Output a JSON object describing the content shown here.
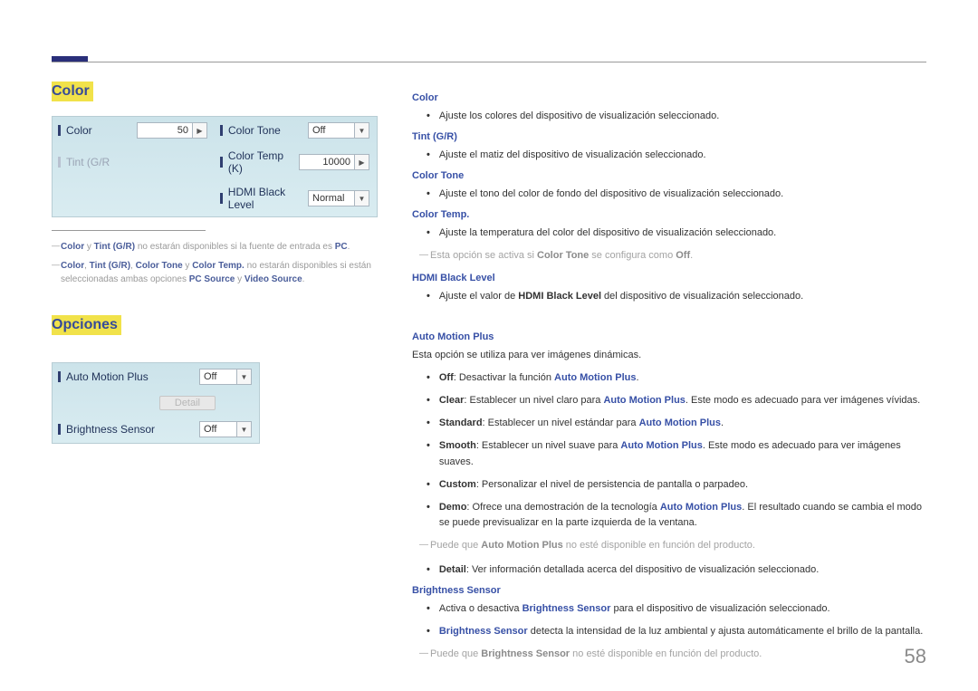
{
  "page_number": "58",
  "left": {
    "section1_title": "Color",
    "panel1": {
      "color_label": "Color",
      "color_value": "50",
      "tint_label": "Tint (G/R",
      "tone_label": "Color Tone",
      "tone_value": "Off",
      "temp_label": "Color Temp (K)",
      "temp_value": "10000",
      "hdmi_label": "HDMI Black Level",
      "hdmi_value": "Normal"
    },
    "fn1": {
      "a": "Color",
      "b": " y ",
      "c": "Tint (G/R)",
      "d": " no estarán disponibles si la fuente de entrada es ",
      "e": "PC",
      "f": "."
    },
    "fn2": {
      "a": "Color",
      "b": ", ",
      "c": "Tint (G/R)",
      "d": ", ",
      "e": "Color Tone",
      "f": " y ",
      "g": "Color Temp.",
      "h": " no estarán disponibles si están seleccionadas ambas opciones ",
      "i": "PC Source",
      "j": " y ",
      "k": "Video Source",
      "l": "."
    },
    "section2_title": "Opciones",
    "panel2": {
      "amp_label": "Auto Motion Plus",
      "amp_value": "Off",
      "detail_label": "Detail",
      "bs_label": "Brightness Sensor",
      "bs_value": "Off"
    }
  },
  "right": {
    "color_head": "Color",
    "color_b1": "Ajuste los colores del dispositivo de visualización seleccionado.",
    "tint_head": "Tint (G/R)",
    "tint_b1": "Ajuste el matiz del dispositivo de visualización seleccionado.",
    "tone_head": "Color Tone",
    "tone_b1": "Ajuste el tono del color de fondo del dispositivo de visualización seleccionado.",
    "temp_head": "Color Temp.",
    "temp_b1": "Ajuste la temperatura del color del dispositivo de visualización seleccionado.",
    "temp_note_a": "Esta opción se activa si ",
    "temp_note_b": "Color Tone",
    "temp_note_c": " se configura como ",
    "temp_note_d": "Off",
    "temp_note_e": ".",
    "hdmi_head": "HDMI Black Level",
    "hdmi_b1_a": "Ajuste el valor de ",
    "hdmi_b1_b": "HDMI Black Level",
    "hdmi_b1_c": " del dispositivo de visualización seleccionado.",
    "amp_head": "Auto Motion Plus",
    "amp_intro": "Esta opción se utiliza para ver imágenes dinámicas.",
    "amp_off_a": "Off",
    "amp_off_b": ": Desactivar la función ",
    "amp_off_c": "Auto Motion Plus",
    "amp_off_d": ".",
    "amp_clear_a": "Clear",
    "amp_clear_b": ": Establecer un nivel claro para ",
    "amp_clear_c": "Auto Motion Plus",
    "amp_clear_d": ". Este modo es adecuado para ver imágenes vívidas.",
    "amp_std_a": "Standard",
    "amp_std_b": ": Establecer un nivel estándar para ",
    "amp_std_c": "Auto Motion Plus",
    "amp_std_d": ".",
    "amp_smooth_a": "Smooth",
    "amp_smooth_b": ": Establecer un nivel suave para ",
    "amp_smooth_c": "Auto Motion Plus",
    "amp_smooth_d": ". Este modo es adecuado para ver imágenes suaves.",
    "amp_custom_a": "Custom",
    "amp_custom_b": ": Personalizar el nivel de persistencia de pantalla o parpadeo.",
    "amp_demo_a": "Demo",
    "amp_demo_b": ": Ofrece una demostración de la tecnología ",
    "amp_demo_c": "Auto Motion Plus",
    "amp_demo_d": ". El resultado cuando se cambia el modo se puede previsualizar en la parte izquierda de la ventana.",
    "amp_note_a": "Puede que ",
    "amp_note_b": "Auto Motion Plus",
    "amp_note_c": " no esté disponible en función del producto.",
    "amp_detail_a": "Detail",
    "amp_detail_b": ": Ver información detallada acerca del dispositivo de visualización seleccionado.",
    "bs_head": "Brightness Sensor",
    "bs_b1_a": "Activa o desactiva ",
    "bs_b1_b": "Brightness Sensor",
    "bs_b1_c": " para el dispositivo de visualización seleccionado.",
    "bs_b2_a": "Brightness Sensor",
    "bs_b2_b": " detecta la intensidad de la luz ambiental y ajusta automáticamente el brillo de la pantalla.",
    "bs_note_a": "Puede que ",
    "bs_note_b": "Brightness Sensor",
    "bs_note_c": " no esté disponible en función del producto."
  }
}
